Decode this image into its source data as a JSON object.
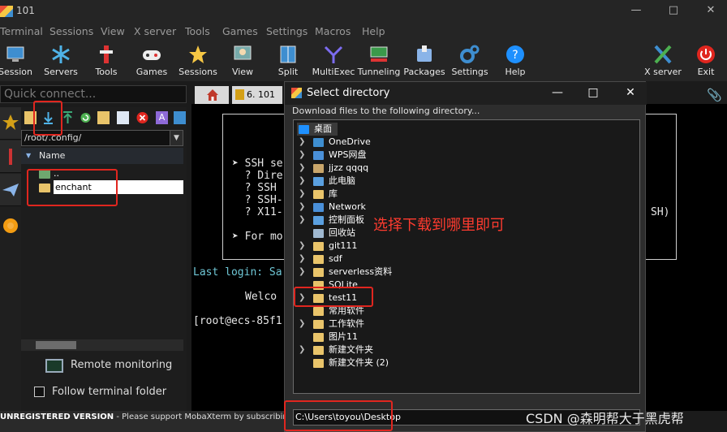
{
  "window": {
    "title": "101"
  },
  "menu": [
    "Terminal",
    "Sessions",
    "View",
    "X server",
    "Tools",
    "Games",
    "Settings",
    "Macros",
    "Help"
  ],
  "toolbar": [
    {
      "label": "Session",
      "icon": "session-icon"
    },
    {
      "label": "Servers",
      "icon": "servers-icon"
    },
    {
      "label": "Tools",
      "icon": "tools-icon"
    },
    {
      "label": "Games",
      "icon": "gamepad-icon"
    },
    {
      "label": "Sessions",
      "icon": "star-icon"
    },
    {
      "label": "View",
      "icon": "view-icon"
    },
    {
      "label": "Split",
      "icon": "split-icon"
    },
    {
      "label": "MultiExec",
      "icon": "multiexec-icon"
    },
    {
      "label": "Tunneling",
      "icon": "tunneling-icon"
    },
    {
      "label": "Packages",
      "icon": "packages-icon"
    },
    {
      "label": "Settings",
      "icon": "gear-icon"
    },
    {
      "label": "Help",
      "icon": "help-icon"
    },
    {
      "label": "X server",
      "icon": "xserver-icon"
    },
    {
      "label": "Exit",
      "icon": "power-icon"
    }
  ],
  "quick_connect": {
    "placeholder": "Quick connect..."
  },
  "sftp": {
    "path": "/root/.config/",
    "column_header": "Name",
    "files": [
      "..",
      "enchant"
    ],
    "remote_monitoring": "Remote monitoring",
    "follow_folder": "Follow terminal folder"
  },
  "status": {
    "bold": "UNREGISTERED VERSION",
    "text": " - Please support MobaXterm by subscribing"
  },
  "tabs": {
    "session_tab": "6. 101"
  },
  "terminal": {
    "lines": [
      "➤ SSH se",
      "  ? Dire",
      "  ? SSH",
      "  ? SSH-",
      "  ? X11-",
      "➤ For mo",
      "Last login: Sa",
      "Welco",
      "[root@ecs-85f1"
    ],
    "right_fragment": "SH)"
  },
  "dialog": {
    "title": "Select directory",
    "description": "Download files to the following directory...",
    "root": "桌面",
    "items": [
      {
        "label": "OneDrive",
        "color": "#3e8ed0",
        "expandable": true
      },
      {
        "label": "WPS网盘",
        "color": "#4a90d9",
        "expandable": true
      },
      {
        "label": "jjzz qqqq",
        "color": "#c9a66b",
        "expandable": true
      },
      {
        "label": "此电脑",
        "color": "#5aa0e0",
        "expandable": true
      },
      {
        "label": "库",
        "color": "#e9c46a",
        "expandable": true
      },
      {
        "label": "Network",
        "color": "#4a90d9",
        "expandable": true
      },
      {
        "label": "控制面板",
        "color": "#5aa0e0",
        "expandable": true
      },
      {
        "label": "回收站",
        "color": "#9fb8d0",
        "expandable": false
      },
      {
        "label": "git111",
        "color": "#e9c46a",
        "expandable": true
      },
      {
        "label": "sdf",
        "color": "#e9c46a",
        "expandable": true
      },
      {
        "label": "serverless资料",
        "color": "#e9c46a",
        "expandable": true
      },
      {
        "label": "SQLite",
        "color": "#e9c46a",
        "expandable": false
      },
      {
        "label": "test11",
        "color": "#e9c46a",
        "expandable": true
      },
      {
        "label": "常用软件",
        "color": "#e9c46a",
        "expandable": false
      },
      {
        "label": "工作软件",
        "color": "#e9c46a",
        "expandable": true
      },
      {
        "label": "图片11",
        "color": "#e9c46a",
        "expandable": false
      },
      {
        "label": "新建文件夹",
        "color": "#e9c46a",
        "expandable": true
      },
      {
        "label": "新建文件夹 (2)",
        "color": "#e9c46a",
        "expandable": false
      }
    ],
    "path": "C:\\Users\\toyou\\Desktop"
  },
  "annotation": {
    "text": "选择下载到哪里即可",
    "color": "#e0261f"
  },
  "watermark": "CSDN @森明帮大于黑虎帮"
}
